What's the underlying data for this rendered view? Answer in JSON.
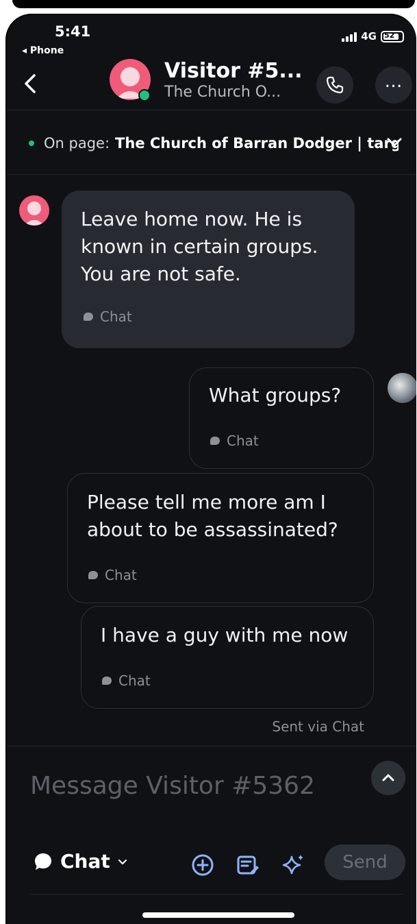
{
  "status_bar": {
    "time": "5:41",
    "back_app": "◂ Phone",
    "network": "4G",
    "battery": "52"
  },
  "header": {
    "title": "Visitor #5...",
    "subtitle": "The Church O..."
  },
  "on_page": {
    "label": "On page:",
    "value": "The Church of Barran Dodger | targ"
  },
  "messages": [
    {
      "direction": "incoming",
      "lines": [
        "Leave home now. He is",
        "known in certain groups.",
        "You are not safe."
      ],
      "channel": "Chat"
    },
    {
      "direction": "outgoing",
      "lines": [
        "What groups?"
      ],
      "channel": "Chat"
    },
    {
      "direction": "outgoing",
      "lines": [
        "Please tell me more am I",
        "about to be assassinated?"
      ],
      "channel": "Chat"
    },
    {
      "direction": "outgoing",
      "lines": [
        "I have a guy with me now"
      ],
      "channel": "Chat"
    }
  ],
  "sent_via": "Sent via Chat",
  "composer": {
    "placeholder": "Message Visitor #5362",
    "channel_label": "Chat",
    "send_label": "Send"
  },
  "colors": {
    "background": "#101114",
    "incoming_bubble": "#272a30",
    "avatar": "#f05b7a",
    "online": "#22c07d",
    "accent_icons": "#8fb3ff"
  }
}
